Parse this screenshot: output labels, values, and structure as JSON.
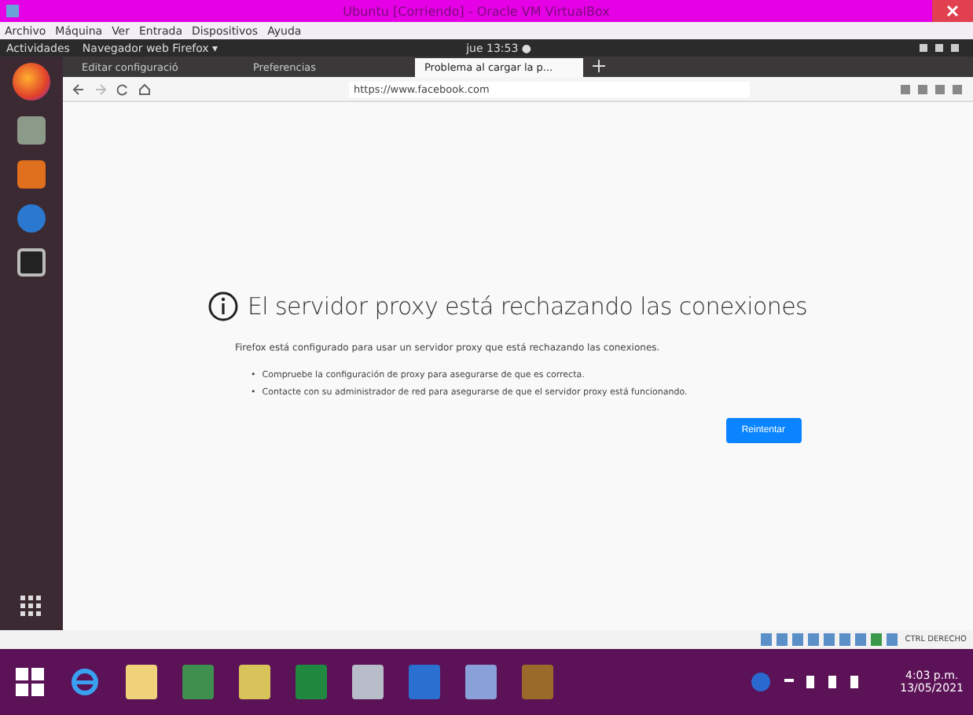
{
  "window": {
    "title": "Ubuntu [Corriendo] - Oracle VM VirtualBox"
  },
  "menu": [
    "Archivo",
    "Máquina",
    "Ver",
    "Entrada",
    "Dispositivos",
    "Ayuda"
  ],
  "topbar": {
    "activities": "Actividades",
    "app": "Navegador web Firefox ▾",
    "clock": "jue 13:53 ●"
  },
  "tabs": [
    {
      "label": "Editar configuració",
      "selected": false
    },
    {
      "label": "Preferencias",
      "selected": false
    },
    {
      "label": "Problema al cargar la p...",
      "selected": true
    }
  ],
  "address": {
    "value": "https://www.facebook.com"
  },
  "error": {
    "title": "El servidor proxy está rechazando las conexiones",
    "text": "Firefox está configurado para usar un servidor proxy que está rechazando las conexiones.",
    "bullet": "•",
    "bullets": [
      "Compruebe la configuración de proxy para asegurarse de que es correcta.",
      "Contacte con su administrador de red para asegurarse de que el servidor proxy está funcionando."
    ],
    "button": "Reintentar"
  },
  "status_bar": {
    "host_key": "CTRL DERECHO"
  },
  "taskbar": {
    "time": "4:03 p.m.",
    "date": "13/05/2021"
  }
}
